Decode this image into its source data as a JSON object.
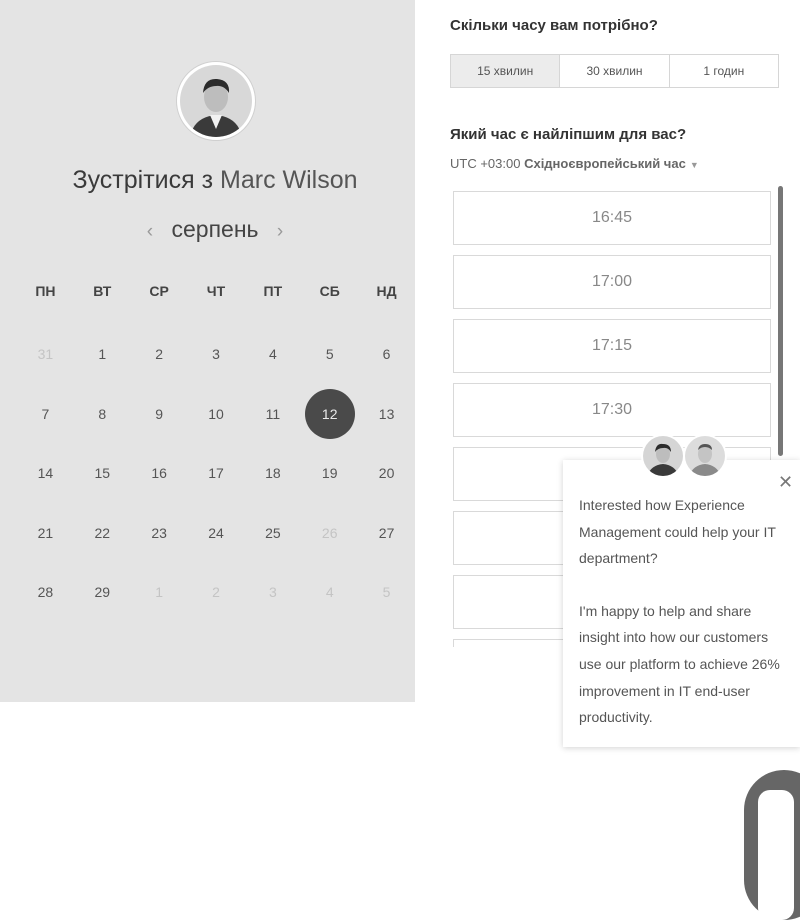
{
  "host": {
    "title_prefix": "Зустрітися з",
    "name": "Marc Wilson"
  },
  "calendar": {
    "month": "серпень",
    "prev_icon": "‹",
    "next_icon": "›",
    "weekdays": [
      "ПН",
      "ВТ",
      "СР",
      "ЧТ",
      "ПТ",
      "СБ",
      "НД"
    ],
    "weeks": [
      [
        "31",
        "1",
        "2",
        "3",
        "4",
        "5",
        "6"
      ],
      [
        "7",
        "8",
        "9",
        "10",
        "11",
        "12",
        "13"
      ],
      [
        "14",
        "15",
        "16",
        "17",
        "18",
        "19",
        "20"
      ],
      [
        "21",
        "22",
        "23",
        "24",
        "25",
        "26",
        "27"
      ],
      [
        "28",
        "29",
        "1",
        "2",
        "3",
        "4",
        "5"
      ]
    ],
    "muted": [
      [
        0,
        0
      ],
      [
        3,
        5
      ],
      [
        4,
        2
      ],
      [
        4,
        3
      ],
      [
        4,
        4
      ],
      [
        4,
        5
      ],
      [
        4,
        6
      ]
    ],
    "selected": [
      1,
      5
    ]
  },
  "duration": {
    "question": "Скільки часу вам потрібно?",
    "options": [
      "15 хвилин",
      "30 хвилин",
      "1 годин"
    ],
    "active_index": 0
  },
  "time": {
    "question": "Який час є найліпшим для вас?",
    "tz_offset": "UTC +03:00",
    "tz_name": "Східноєвропейський час",
    "slots": [
      "16:45",
      "17:00",
      "17:15",
      "17:30",
      "",
      "",
      "",
      ""
    ]
  },
  "popup": {
    "paragraphs": [
      "Interested how Experience Management could help your IT department?",
      "I'm happy to help and share insight into how our customers use our platform to achieve 26% improvement in IT end-user productivity."
    ],
    "close_icon": "✕"
  },
  "colors": {
    "selected_day": "#4a4a4a",
    "panel_bg": "#e4e4e4"
  }
}
